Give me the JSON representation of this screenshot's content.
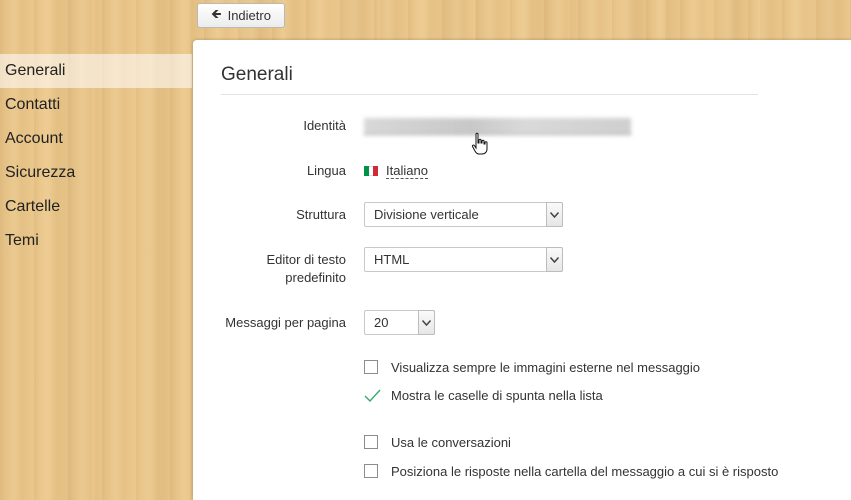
{
  "toolbar": {
    "back_label": "Indietro"
  },
  "sidebar": {
    "items": [
      {
        "label": "Generali",
        "active": true
      },
      {
        "label": "Contatti"
      },
      {
        "label": "Account"
      },
      {
        "label": "Sicurezza"
      },
      {
        "label": "Cartelle"
      },
      {
        "label": "Temi"
      }
    ]
  },
  "panel": {
    "title": "Generali",
    "identity": {
      "label": "Identità"
    },
    "language": {
      "label": "Lingua",
      "value": "Italiano",
      "flag_colors": [
        "#009246",
        "#ffffff",
        "#ce2b37"
      ]
    },
    "layout": {
      "label": "Struttura",
      "value": "Divisione verticale"
    },
    "editor": {
      "label_line1": "Editor di testo",
      "label_line2": "predefinito",
      "value": "HTML"
    },
    "per_page": {
      "label": "Messaggi per pagina",
      "value": "20"
    },
    "options": [
      {
        "label": "Visualizza sempre le immagini esterne nel messaggio",
        "checked": false
      },
      {
        "label": "Mostra le caselle di spunta nella lista",
        "checked": true
      },
      {
        "label": "Usa le conversazioni",
        "checked": false
      },
      {
        "label": "Posiziona le risposte nella cartella del messaggio a cui si è risposto",
        "checked": false
      }
    ]
  },
  "colors": {
    "check": "#3aa86a",
    "panel_bg": "#ffffff",
    "wood": "#ecc98e"
  }
}
